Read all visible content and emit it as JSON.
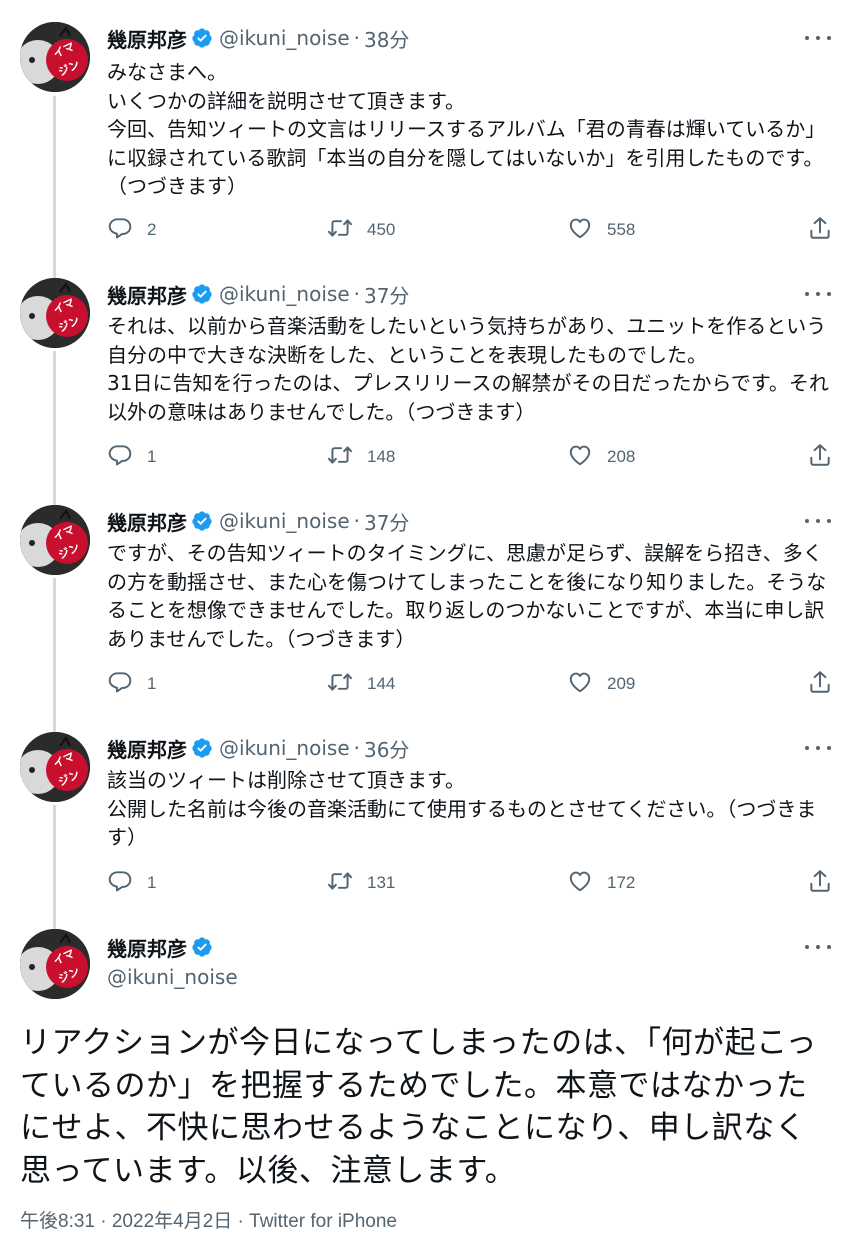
{
  "author": {
    "name": "幾原邦彦",
    "handle": "@ikuni_noise",
    "avatar_label": "イマジン"
  },
  "tweets": [
    {
      "time": "38分",
      "text": "みなさまへ。\nいくつかの詳細を説明させて頂きます。\n今回、告知ツィートの文言はリリースするアルバム「君の青春は輝いているか」に収録されている歌詞「本当の自分を隠してはいないか」を引用したものです。（つづきます）",
      "replies": "2",
      "retweets": "450",
      "likes": "558"
    },
    {
      "time": "37分",
      "text": "それは、以前から音楽活動をしたいという気持ちがあり、ユニットを作るという自分の中で大きな決断をした、ということを表現したものでした。\n31日に告知を行ったのは、プレスリリースの解禁がその日だったからです。それ以外の意味はありませんでした。（つづきます）",
      "replies": "1",
      "retweets": "148",
      "likes": "208"
    },
    {
      "time": "37分",
      "text": "ですが、その告知ツィートのタイミングに、思慮が足らず、誤解をら招き、多くの方を動揺させ、また心を傷つけてしまったことを後になり知りました。そうなることを想像できませんでした。取り返しのつかないことですが、本当に申し訳ありませんでした。（つづきます）",
      "replies": "1",
      "retweets": "144",
      "likes": "209"
    },
    {
      "time": "36分",
      "text": "該当のツィートは削除させて頂きます。\n公開した名前は今後の音楽活動にて使用するものとさせてください。（つづきます）",
      "replies": "1",
      "retweets": "131",
      "likes": "172"
    }
  ],
  "main_tweet": {
    "text": "リアクションが今日になってしまったのは、「何が起こっているのか」を把握するためでした。本意ではなかったにせよ、不快に思わせるようなことになり、申し訳なく思っています。以後、注意します。",
    "meta": "午後8:31 · 2022年4月2日 · Twitter for iPhone"
  },
  "icons": {
    "reply": "reply-icon",
    "retweet": "retweet-icon",
    "like": "heart-icon",
    "share": "share-icon",
    "verified": "verified-badge-icon",
    "more": "more-options-icon"
  },
  "colors": {
    "text": "#0f1419",
    "secondary": "#536471",
    "verified": "#1d9bf0",
    "thread_line": "#cfd9de",
    "avatar_red": "#c8102e"
  }
}
